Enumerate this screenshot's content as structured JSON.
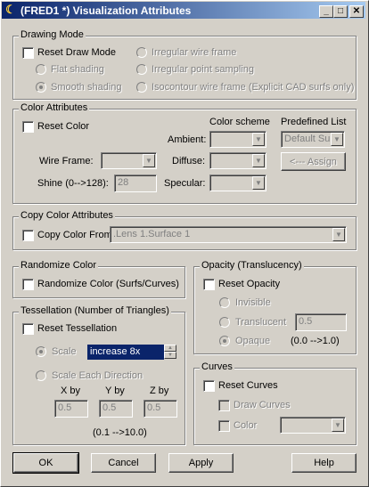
{
  "window": {
    "title": "(FRED1 *) Visualization Attributes",
    "min_glyph": "_",
    "max_glyph": "□",
    "close_glyph": "✕",
    "app_glyph": "☾"
  },
  "drawing_mode": {
    "title": "Drawing Mode",
    "reset_label": "Reset Draw Mode",
    "flat": "Flat shading",
    "smooth": "Smooth shading",
    "irregular_wire": "Irregular wire frame",
    "irregular_point": "Irregular point sampling",
    "isocontour": "Isocontour wire frame (Explicit CAD surfs only)"
  },
  "color_attributes": {
    "title": "Color Attributes",
    "reset_label": "Reset Color",
    "scheme_header": "Color scheme",
    "predefined_header": "Predefined List",
    "ambient": "Ambient:",
    "diffuse": "Diffuse:",
    "specular": "Specular:",
    "wire_frame": "Wire Frame:",
    "shine": "Shine (0-->128):",
    "shine_value": "28",
    "predefined_value": "Default Sur",
    "assign_button": "<--- Assign"
  },
  "copy_color": {
    "title": "Copy Color Attributes",
    "checkbox_label": "Copy Color From",
    "source_value": ".Lens 1.Surface 1"
  },
  "randomize": {
    "title": "Randomize Color",
    "checkbox_label": "Randomize Color (Surfs/Curves)"
  },
  "opacity": {
    "title": "Opacity (Translucency)",
    "reset_label": "Reset Opacity",
    "invisible": "Invisible",
    "translucent": "Translucent",
    "translucent_value": "0.5",
    "opaque": "Opaque",
    "range": "(0.0 -->1.0)"
  },
  "tessellation": {
    "title": "Tessellation (Number of Triangles)",
    "reset_label": "Reset Tessellation",
    "scale": "Scale",
    "scale_value": "increase 8x",
    "scale_each": "Scale Each Direction",
    "x_by": "X by",
    "y_by": "Y by",
    "z_by": "Z by",
    "x_value": "0.5",
    "y_value": "0.5",
    "z_value": "0.5",
    "range": "(0.1 -->10.0)"
  },
  "curves": {
    "title": "Curves",
    "reset_label": "Reset Curves",
    "draw_label": "Draw Curves",
    "color_label": "Color"
  },
  "buttons": {
    "ok": "OK",
    "cancel": "Cancel",
    "apply": "Apply",
    "help": "Help"
  }
}
